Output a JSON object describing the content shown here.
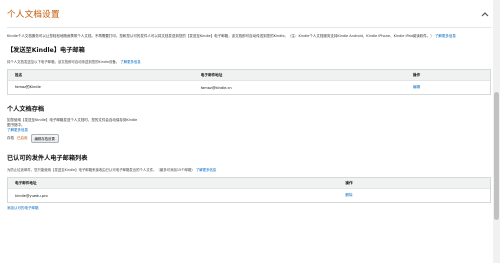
{
  "section": {
    "title": "个人文档设置",
    "intro_text": "Kindle个人文档服务可以让您轻松地随身携带个人文档。不再需要打印。您和您认可的发件人可以将文档发送到您的【发送至Kindle】电子邮箱，该文档即可自动传送到您的Kindle。（注：Kindle个人文档服务支持Kindle Android、Kindle iPhone、Kindle iPad阅读软件。）",
    "intro_link": "了解更多信息"
  },
  "send_to_kindle": {
    "heading": "【发送至Kindle】电子邮箱",
    "desc": "将个人文档发送至以下电子邮箱，该文档即可自动传送到您的Kindle设备。",
    "desc_link": "了解更多信息",
    "columns": [
      "姓名",
      "电子邮件地址",
      "操作"
    ],
    "rows": [
      {
        "name": "famaz的Kindle",
        "email": "famaz@kindle.cn",
        "action": "编辑"
      }
    ]
  },
  "archive": {
    "heading": "个人文档存档",
    "text_1": "如您使用【发送至Kindle】电子邮箱发送个人文档时，您的文件会自动保存到Kindle",
    "text_2": "图书馆中。",
    "learn_more": "了解更多信息",
    "state_label": "存档",
    "state_value": "已启用",
    "edit_button": "编辑存档设置"
  },
  "approved_senders": {
    "heading": "已认可的发件人电子邮箱列表",
    "desc": "为防止垃圾邮件，您只能使用【发送至Kindle】电子邮箱来接收由已认可电子邮箱发出的个人文件。（最多可添加15个邮箱）",
    "desc_link": "了解更多信息",
    "columns": [
      "电子邮件地址",
      "操作"
    ],
    "rows": [
      {
        "email": "kindle@yuedu.pro",
        "action": "删除"
      }
    ],
    "add_link": "添加认可的电子邮箱"
  },
  "colors": {
    "accent": "#c45500",
    "link": "#0066c0"
  }
}
